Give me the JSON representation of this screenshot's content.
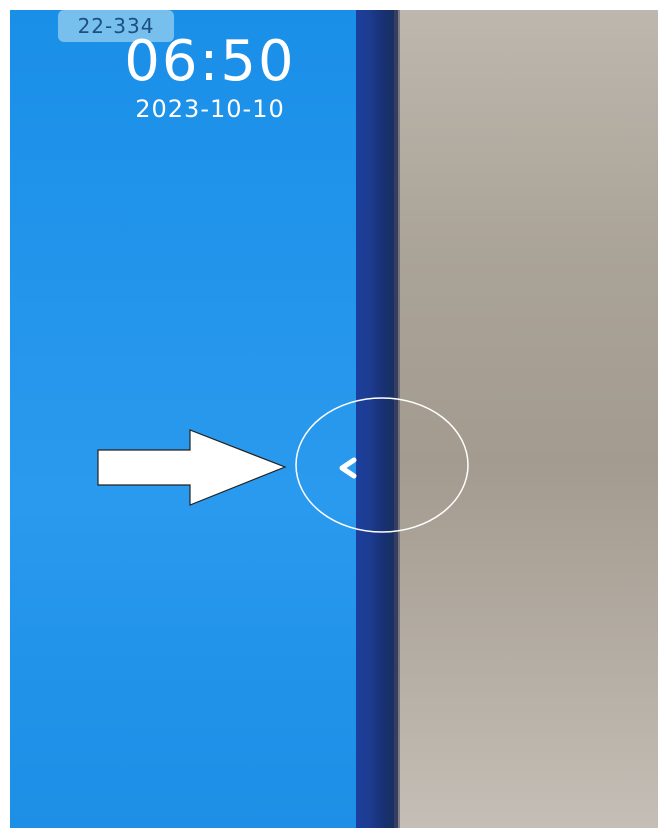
{
  "screen": {
    "badge": "22-334",
    "time": "06:50",
    "date": "2023-10-10"
  },
  "colors": {
    "screen_blue": "#1f93ea",
    "bezel_navy": "#1d3c92",
    "wall_beige": "#aaa397"
  },
  "icons": {
    "back_chevron": "chevron-left-icon",
    "annotation_arrow": "arrow-right-icon",
    "annotation_circle": "circle-highlight"
  }
}
